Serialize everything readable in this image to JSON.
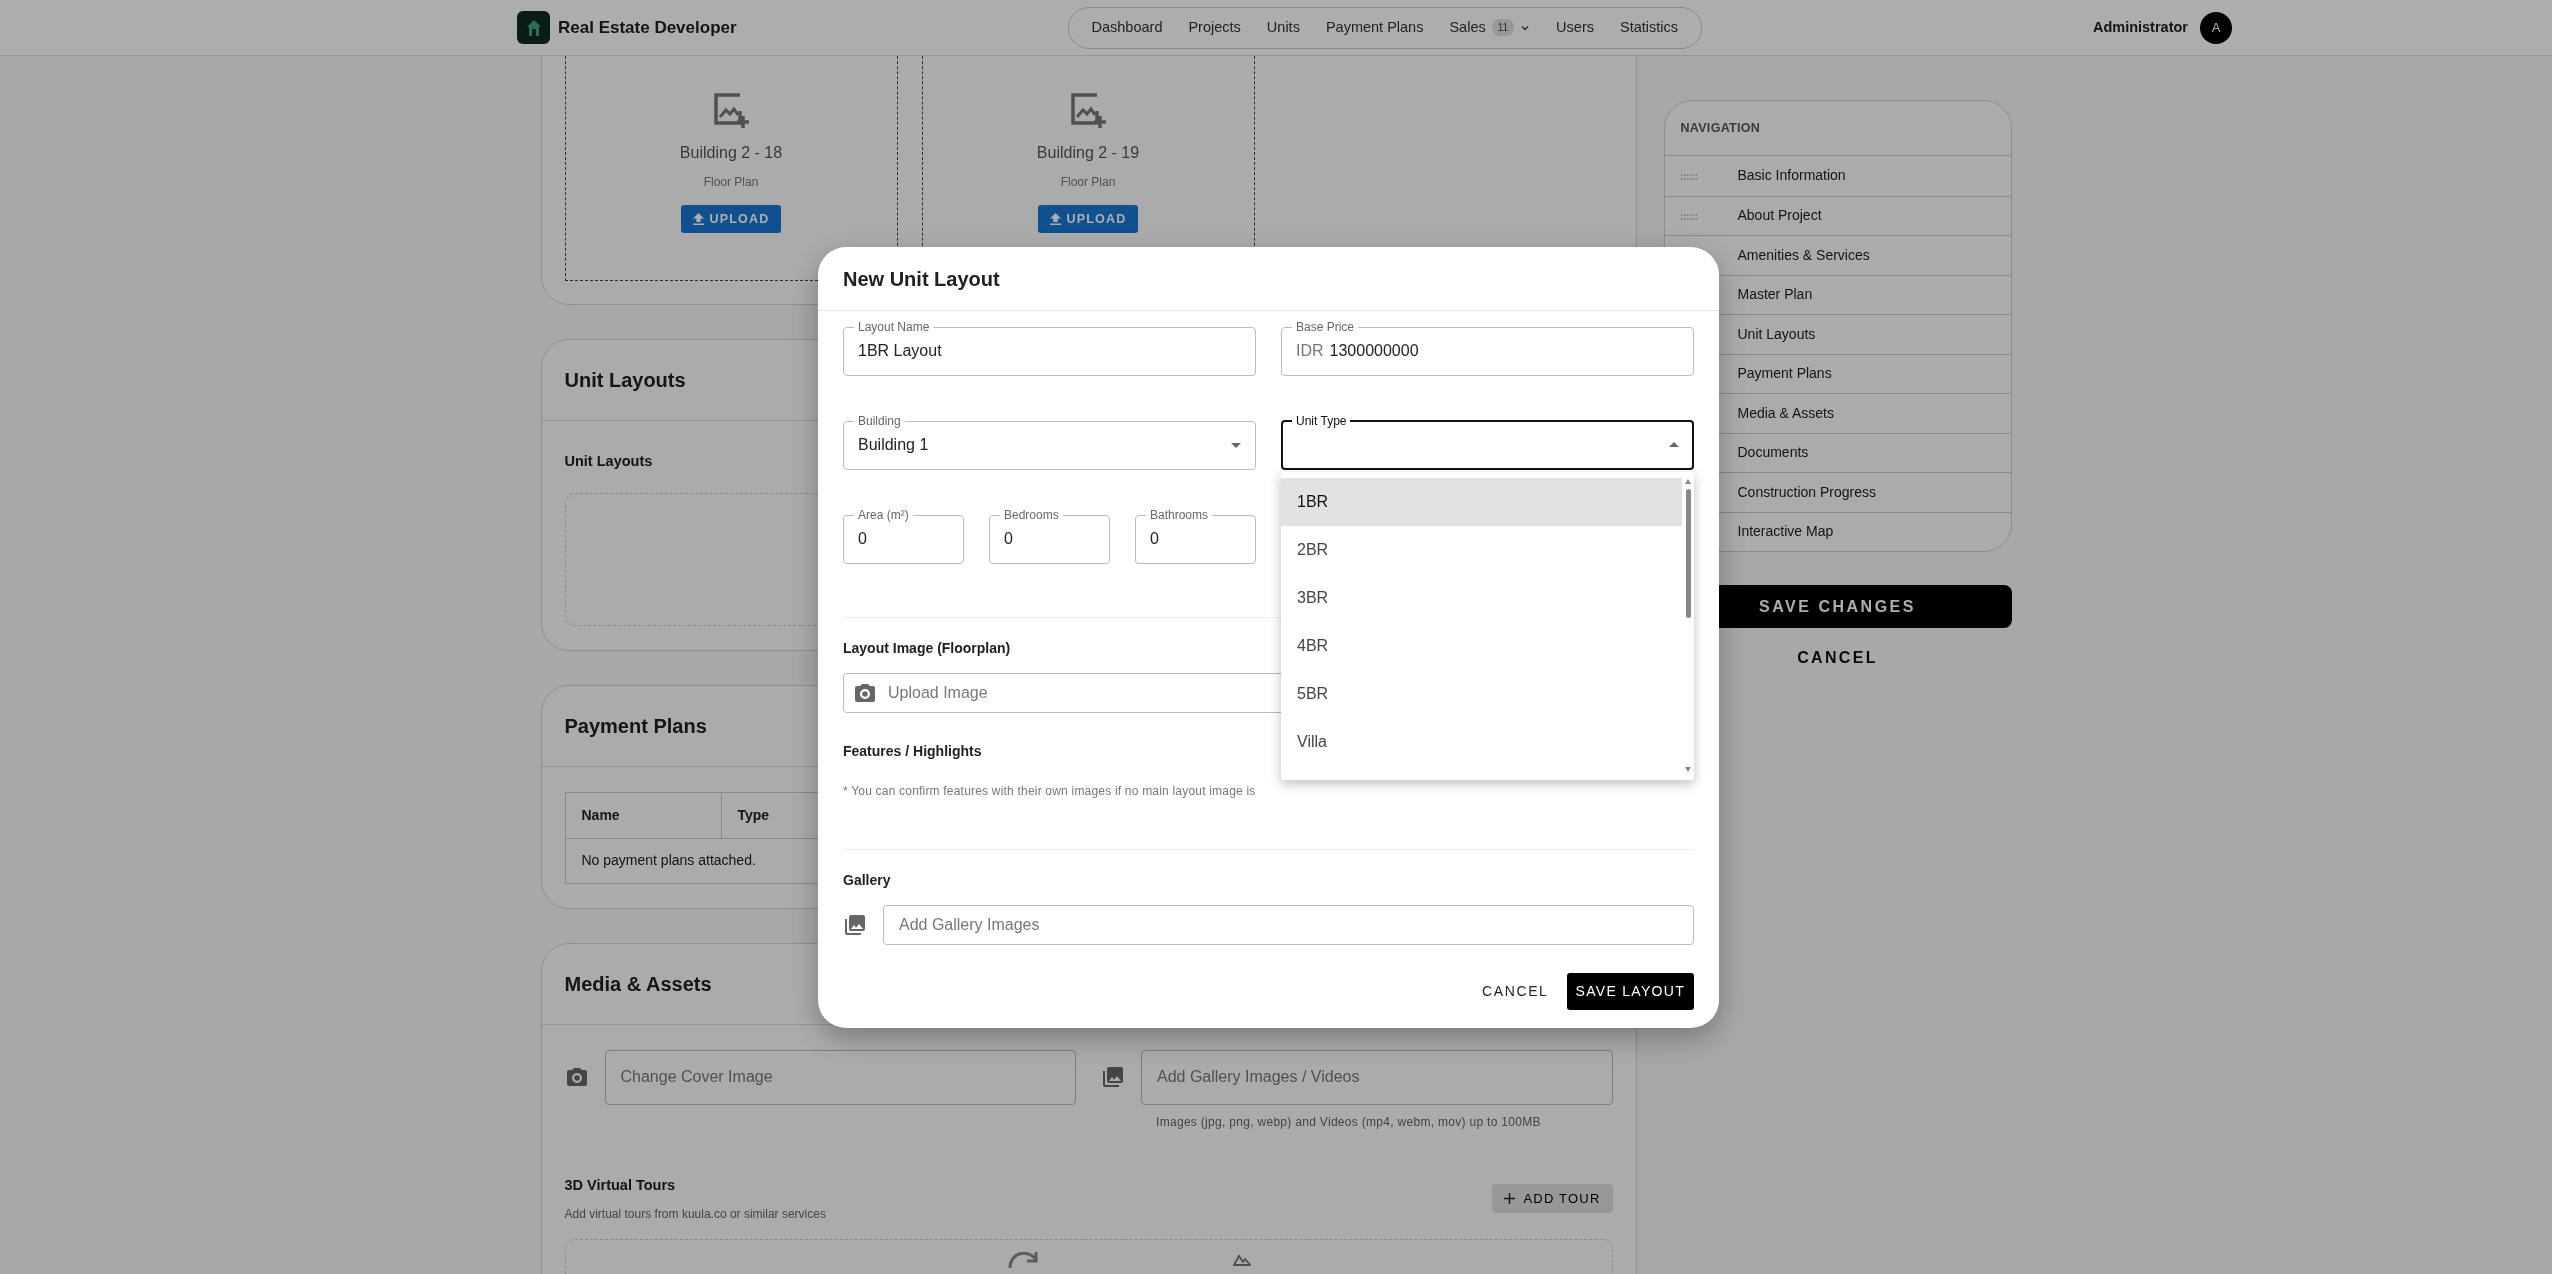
{
  "navbar": {
    "brand": "Real Estate Developer",
    "links": [
      {
        "label": "Dashboard"
      },
      {
        "label": "Projects"
      },
      {
        "label": "Units"
      },
      {
        "label": "Payment Plans"
      },
      {
        "label": "Sales",
        "badge": "11",
        "dropdown": true
      },
      {
        "label": "Users"
      },
      {
        "label": "Statistics"
      }
    ],
    "user": "Administrator",
    "avatar": "A"
  },
  "content": {
    "upload_tiles": [
      {
        "title": "Building 2 - 18",
        "subtitle": "Floor Plan",
        "button": "UPLOAD"
      },
      {
        "title": "Building 2 - 19",
        "subtitle": "Floor Plan",
        "button": "UPLOAD"
      }
    ],
    "unit_layouts": {
      "title": "Unit Layouts",
      "subtitle": "Unit Layouts"
    },
    "payment_plans": {
      "title": "Payment Plans",
      "columns": [
        "Name",
        "Type"
      ],
      "empty_text": "No payment plans attached."
    },
    "media_assets": {
      "title": "Media & Assets",
      "cover_placeholder": "Change Cover Image",
      "gallery_placeholder": "Add Gallery Images / Videos",
      "gallery_hint": "Images (jpg, png, webp) and Videos (mp4, webm, mov) up to 100MB",
      "tours_title": "3D Virtual Tours",
      "tours_hint": "Add virtual tours from kuula.co or similar services",
      "add_tour": "ADD TOUR"
    }
  },
  "sidebar": {
    "heading": "NAVIGATION",
    "items": [
      {
        "label": "Basic Information",
        "handle": true
      },
      {
        "label": "About Project",
        "handle": true
      },
      {
        "label": "Amenities & Services",
        "handle": false
      },
      {
        "label": "Master Plan",
        "handle": false
      },
      {
        "label": "Unit Layouts",
        "handle": false
      },
      {
        "label": "Payment Plans",
        "handle": false
      },
      {
        "label": "Media & Assets",
        "handle": false
      },
      {
        "label": "Documents",
        "handle": false
      },
      {
        "label": "Construction Progress",
        "handle": false
      },
      {
        "label": "Interactive Map",
        "handle": false
      }
    ],
    "save": "SAVE CHANGES",
    "cancel": "CANCEL"
  },
  "modal": {
    "title": "New Unit Layout",
    "fields": [
      {
        "kind": "text",
        "label": "Layout Name",
        "value": "1BR Layout"
      },
      {
        "kind": "currency",
        "label": "Base Price",
        "prefix": "IDR",
        "value": "1300000000"
      },
      {
        "kind": "select",
        "label": "Building",
        "value": "Building 1",
        "open": false
      },
      {
        "kind": "select",
        "label": "Unit Type",
        "open": true,
        "options": [
          {
            "label": "1BR",
            "selected": true
          },
          {
            "label": "2BR",
            "selected": false
          },
          {
            "label": "3BR",
            "selected": false
          },
          {
            "label": "4BR",
            "selected": false
          },
          {
            "label": "5BR",
            "selected": false
          },
          {
            "label": "Villa",
            "selected": false
          }
        ]
      }
    ],
    "small_fields": [
      {
        "label": "Area (m²)",
        "value": "0"
      },
      {
        "label": "Bedrooms",
        "value": "0"
      },
      {
        "label": "Bathrooms",
        "value": "0"
      }
    ],
    "layout_image": {
      "title": "Layout Image (Floorplan)",
      "placeholder": "Upload Image"
    },
    "features": {
      "title": "Features / Highlights",
      "hint": "* You can confirm features with their own images if no main layout image is"
    },
    "gallery": {
      "title": "Gallery",
      "placeholder": "Add Gallery Images"
    },
    "cancel": "CANCEL",
    "save": "SAVE LAYOUT"
  }
}
